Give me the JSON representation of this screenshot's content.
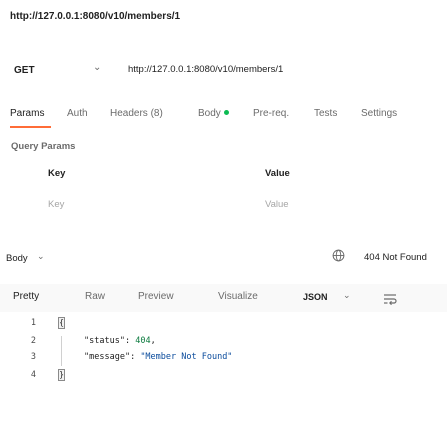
{
  "page": {
    "url_title": "http://127.0.0.1:8080/v10/members/1"
  },
  "request": {
    "method": "GET",
    "method_chevron": "⌄",
    "url": "http://127.0.0.1:8080/v10/members/1"
  },
  "tabs": [
    {
      "label": "Params",
      "active": true
    },
    {
      "label": "Auth"
    },
    {
      "label": "Headers (8)"
    },
    {
      "label": "Body"
    },
    {
      "label": "Pre-req."
    },
    {
      "label": "Tests"
    },
    {
      "label": "Settings"
    }
  ],
  "query_params": {
    "title": "Query Params",
    "key_header": "Key",
    "value_header": "Value",
    "key_placeholder": "Key",
    "value_placeholder": "Value"
  },
  "response": {
    "body_label": "Body",
    "body_chevron": "⌄",
    "status": "404 Not Found",
    "globe_icon": "globe-icon"
  },
  "format": {
    "tabs": [
      "Pretty",
      "Raw",
      "Preview",
      "Visualize"
    ],
    "active": "Pretty",
    "type": "JSON",
    "type_chevron": "⌄",
    "wrap_icon": "wrap-lines-icon"
  },
  "code": {
    "line_numbers": [
      "1",
      "2",
      "3",
      "4"
    ],
    "open_brace": "{",
    "close_brace": "}",
    "lines": [
      {
        "key": "\"status\"",
        "sep": ": ",
        "value": "404",
        "trail": ","
      },
      {
        "key": "\"message\"",
        "sep": ": ",
        "value": "\"Member Not Found\"",
        "trail": ""
      }
    ]
  },
  "colors": {
    "accent": "#ff6c37",
    "body_dot": "#0cbb52",
    "json_number": "#0b7a3e",
    "json_string": "#0a4b9c"
  }
}
